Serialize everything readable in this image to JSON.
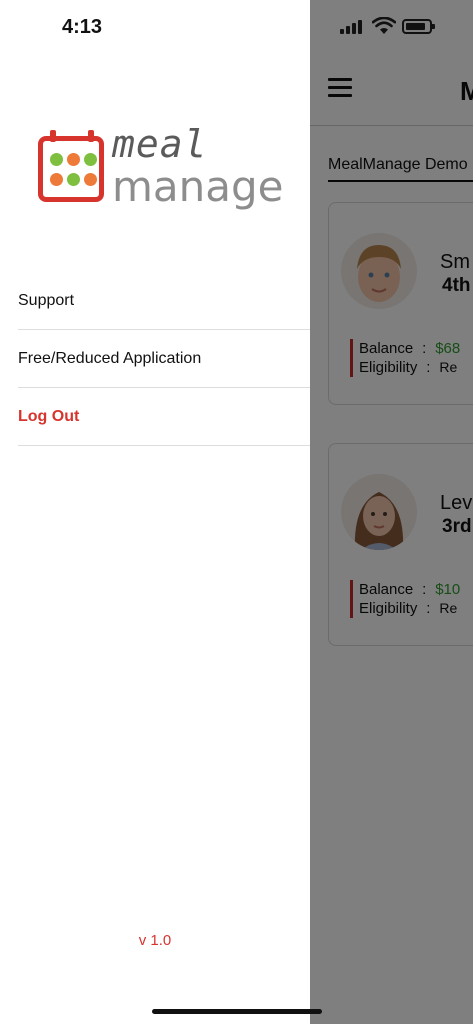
{
  "status_bar": {
    "time": "4:13"
  },
  "drawer": {
    "logo": {
      "word1": "meal",
      "word2": "manage"
    },
    "menu": [
      {
        "label": "Support"
      },
      {
        "label": "Free/Reduced Application"
      },
      {
        "label": "Log Out"
      }
    ],
    "version": "v 1.0"
  },
  "background_app": {
    "header_title": "M",
    "tab_label": "MealManage Demo",
    "students": [
      {
        "name": "Sm",
        "grade": "4th",
        "balance_label": "Balance",
        "balance": "$68",
        "eligibility_label": "Eligibility",
        "eligibility": "Re"
      },
      {
        "name": "Lev",
        "grade": "3rd",
        "balance_label": "Balance",
        "balance": "$10",
        "eligibility_label": "Eligibility",
        "eligibility": "Re"
      }
    ]
  },
  "colors": {
    "accent_red": "#d8342e",
    "balance_green": "#2e9b2e",
    "logo_orange": "#ee7a3a",
    "logo_green": "#7fbf3f"
  }
}
